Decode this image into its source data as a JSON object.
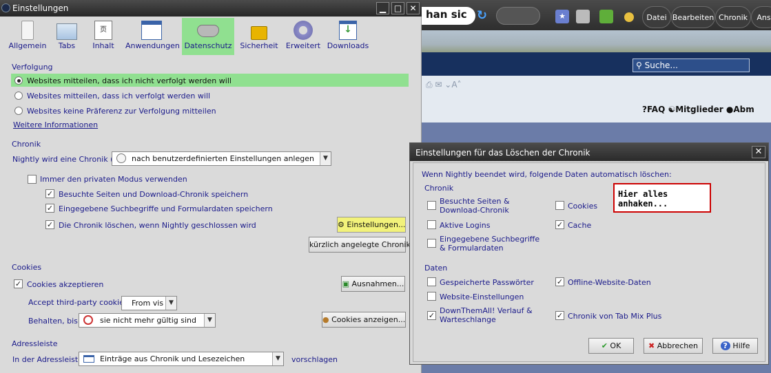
{
  "background_browser": {
    "url_text": "han sic",
    "menu": [
      "Datei",
      "Bearbeiten",
      "Chronik",
      "Ansi"
    ],
    "search_placeholder": "Suche...",
    "nav_faq": "FAQ",
    "nav_members": "Mitglieder",
    "nav_abm": "Abm"
  },
  "settings_window": {
    "title": "Einstellungen",
    "categories": [
      {
        "label": "Allgemein",
        "icon": "switch-icon"
      },
      {
        "label": "Tabs",
        "icon": "folder-tabs-icon"
      },
      {
        "label": "Inhalt",
        "icon": "document-icon"
      },
      {
        "label": "Anwendungen",
        "icon": "calendar-icon"
      },
      {
        "label": "Datenschutz",
        "icon": "mask-icon"
      },
      {
        "label": "Sicherheit",
        "icon": "padlock-icon"
      },
      {
        "label": "Erweitert",
        "icon": "gear-icon"
      },
      {
        "label": "Downloads",
        "icon": "download-icon"
      }
    ],
    "selected_category": "Datenschutz",
    "tracking": {
      "heading": "Verfolgung",
      "options": [
        "Websites mitteilen, dass ich nicht verfolgt werden will",
        "Websites mitteilen, dass ich verfolgt werden will",
        "Websites keine Präferenz zur Verfolgung mitteilen"
      ],
      "selected": 0,
      "more_info": "Weitere Informationen"
    },
    "history": {
      "heading": "Chronik",
      "label": "Nightly wird eine Chronik (F):",
      "mode_value": "nach benutzerdefinierten Einstellungen anlegen",
      "private_mode": "Immer den privaten Modus verwenden",
      "private_mode_checked": false,
      "visited": "Besuchte Seiten und Download-Chronik speichern",
      "visited_checked": true,
      "searches": "Eingegebene Suchbegriffe und Formulardaten speichern",
      "searches_checked": true,
      "clear_on_close": "Die Chronik löschen, wenn Nightly geschlossen wird",
      "clear_on_close_checked": true,
      "settings_button": "Einstellungen...",
      "recent_button": "kürzlich angelegte Chronik"
    },
    "cookies": {
      "heading": "Cookies",
      "accept": "Cookies akzeptieren",
      "accept_checked": true,
      "exceptions_button": "Ausnahmen...",
      "third_party_label": "Accept third-party cookies:",
      "third_party_value": "From vis",
      "keep_label": "Behalten, bis:",
      "keep_value": "sie nicht mehr gültig sind",
      "show_button": "Cookies anzeigen..."
    },
    "address_bar": {
      "heading": "Adressleiste",
      "label": "In der Adressleiste",
      "value": "Einträge aus Chronik und Lesezeichen",
      "suffix": "vorschlagen"
    }
  },
  "dialog": {
    "title": "Einstellungen für das Löschen der Chronik",
    "intro": "Wenn Nightly beendet wird, folgende Daten automatisch löschen:",
    "history_heading": "Chronik",
    "history_items": [
      {
        "label": "Besuchte Seiten & Download-Chronik",
        "checked": false
      },
      {
        "label": "Cookies",
        "checked": false
      },
      {
        "label": "Aktive Logins",
        "checked": false
      },
      {
        "label": "Cache",
        "checked": true
      },
      {
        "label": "Eingegebene Suchbegriffe & Formulardaten",
        "checked": false
      }
    ],
    "data_heading": "Daten",
    "data_items": [
      {
        "label": "Gespeicherte Passwörter",
        "checked": false
      },
      {
        "label": "Offline-Website-Daten",
        "checked": true
      },
      {
        "label": "Website-Einstellungen",
        "checked": false
      },
      {
        "label": "DownThemAll! Verlauf & Warteschlange",
        "checked": true
      },
      {
        "label": "Chronik von Tab Mix Plus",
        "checked": true
      }
    ],
    "ok": "OK",
    "cancel": "Abbrechen",
    "help": "Hilfe"
  },
  "annotation": "Hier alles anhaken...",
  "colors": {
    "selected_category": "#90e090",
    "highlight_button": "#f2f27a",
    "callout_border": "#cc0000"
  }
}
